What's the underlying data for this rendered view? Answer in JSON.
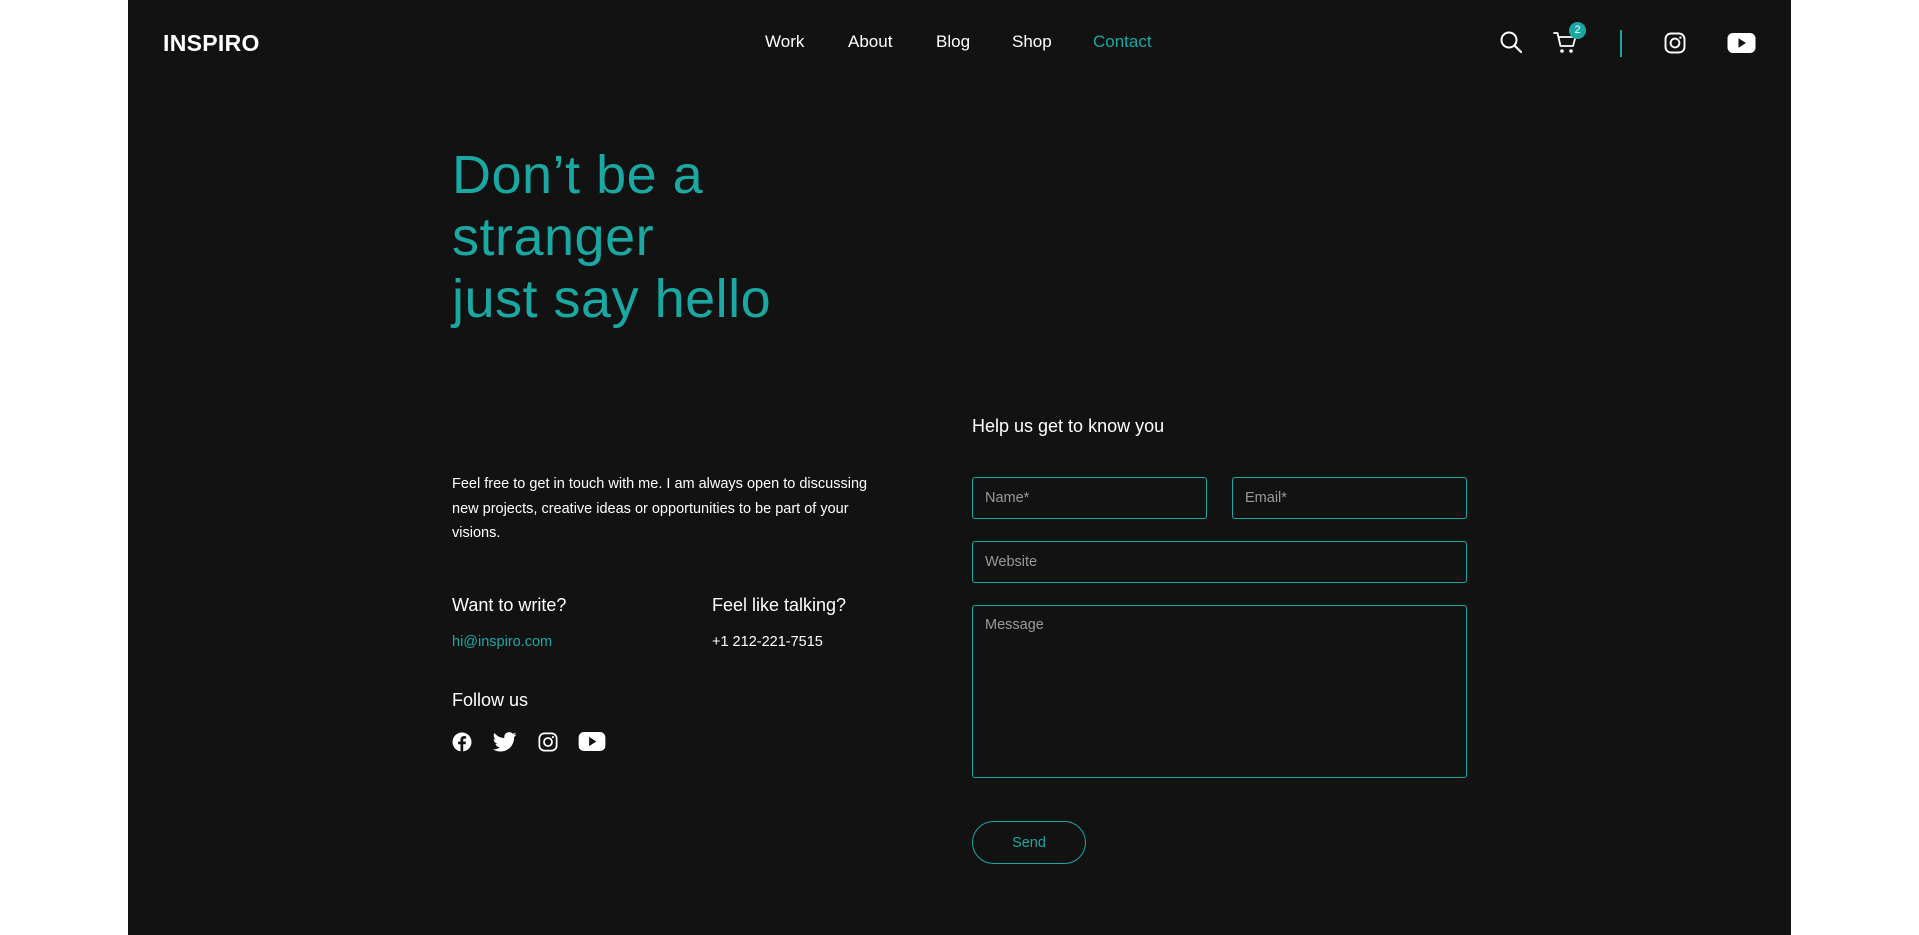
{
  "brand": {
    "logo": "INSPIRO",
    "accent": "#1aa8a3",
    "background": "#121212"
  },
  "nav": {
    "items": [
      {
        "label": "Work"
      },
      {
        "label": "About"
      },
      {
        "label": "Blog"
      },
      {
        "label": "Shop"
      },
      {
        "label": "Contact",
        "active": true
      }
    ]
  },
  "header_icons": [
    "search-icon",
    "cart-icon",
    "instagram-icon",
    "youtube-icon"
  ],
  "cart": {
    "count": "2"
  },
  "hero": {
    "lines": [
      "Don’t be a",
      "stranger",
      "just say hello"
    ]
  },
  "intro": "Feel free to get in touch with me. I am always open to discussing new projects, creative ideas or opportunities to be part of your visions.",
  "contact": {
    "write_title": "Want to write?",
    "email": "hi@inspiro.com",
    "talk_title": "Feel like talking?",
    "phone": "+1 212-221-7515"
  },
  "follow": {
    "title": "Follow us",
    "icons": [
      "facebook-icon",
      "twitter-icon",
      "instagram-icon",
      "youtube-icon"
    ]
  },
  "form": {
    "title": "Help us get to know you",
    "name_placeholder": "Name*",
    "email_placeholder": "Email*",
    "website_placeholder": "Website",
    "message_placeholder": "Message",
    "submit_label": "Send"
  }
}
